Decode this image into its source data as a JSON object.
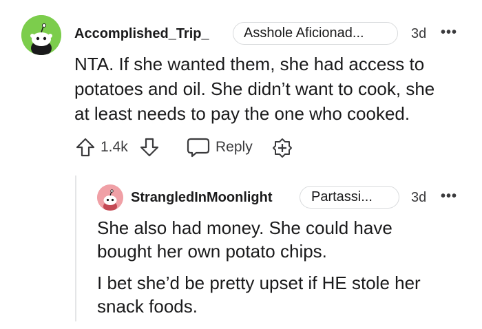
{
  "comment": {
    "username": "Accomplished_Trip_",
    "flair": "Asshole Aficionad...",
    "time": "3d",
    "more": "•••",
    "body_lines": [
      "NTA. If she wanted them, she had access to",
      "potatoes and oil. She didn’t want to cook, she",
      "at least needs to pay the one who cooked."
    ],
    "votes": "1.4k",
    "reply_label": "Reply",
    "avatar_color": "#7ccd4c"
  },
  "reply": {
    "username": "StrangledInMoonlight",
    "flair": "Partassi...",
    "time": "3d",
    "more": "•••",
    "paragraphs": [
      [
        "She also had money. She could have",
        "bought her own potato chips."
      ],
      [
        "I bet she’d be pretty upset if HE stole her",
        "snack foods."
      ]
    ],
    "avatar_color": "#f0a0a6"
  }
}
